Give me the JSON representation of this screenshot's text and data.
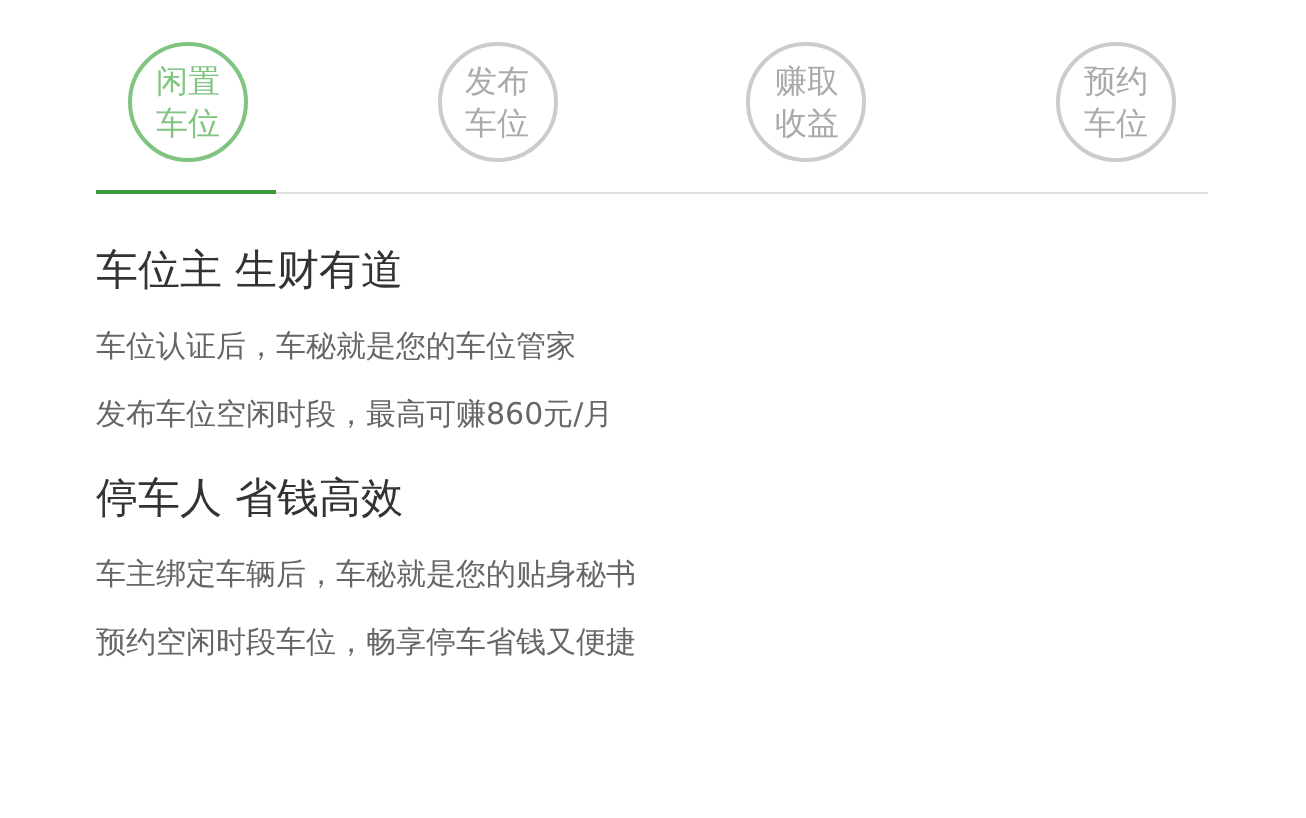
{
  "tabs": [
    {
      "label": "闲置车位",
      "selected": true
    },
    {
      "label": "发布车位",
      "selected": false
    },
    {
      "label": "赚取收益",
      "selected": false
    },
    {
      "label": "预约车位",
      "selected": false
    }
  ],
  "sections": [
    {
      "heading": "车位主 生财有道",
      "lines": [
        "车位认证后，车秘就是您的车位管家",
        "发布车位空闲时段，最高可赚860元/月"
      ]
    },
    {
      "heading": "停车人 省钱高效",
      "lines": [
        "车主绑定车辆后，车秘就是您的贴身秘书",
        "预约空闲时段车位，畅享停车省钱又便捷"
      ]
    }
  ]
}
